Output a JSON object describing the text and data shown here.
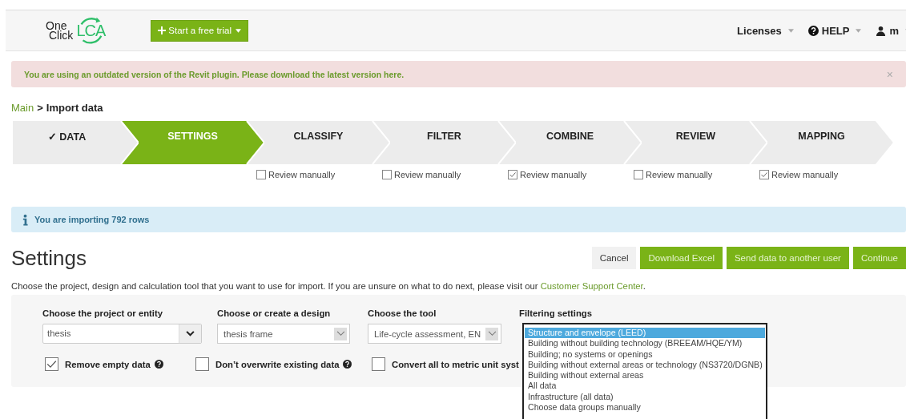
{
  "header": {
    "logo": {
      "line1": "One",
      "line2": "Click",
      "mark": "LCA"
    },
    "trial_button": "Start a free trial",
    "menu": [
      {
        "kind": "plain",
        "label": "Licenses"
      },
      {
        "kind": "help",
        "label": "HELP"
      },
      {
        "kind": "user",
        "label": "m"
      }
    ]
  },
  "alert": {
    "text": "You are using an outdated version of the Revit plugin. Please download the latest version here.",
    "close": "×"
  },
  "breadcrumb": {
    "link": "Main",
    "separator": ">",
    "current": "Import data"
  },
  "steps": [
    {
      "label": "✓ DATA",
      "selected": false
    },
    {
      "label": "SETTINGS",
      "selected": true
    },
    {
      "label": "CLASSIFY",
      "selected": false,
      "review": {
        "label": "Review manually",
        "checked": false
      }
    },
    {
      "label": "FILTER",
      "selected": false,
      "review": {
        "label": "Review manually",
        "checked": false
      }
    },
    {
      "label": "COMBINE",
      "selected": false,
      "review": {
        "label": "Review manually",
        "checked": true
      }
    },
    {
      "label": "REVIEW",
      "selected": false,
      "review": {
        "label": "Review manually",
        "checked": false
      }
    },
    {
      "label": "MAPPING",
      "selected": false,
      "review": {
        "label": "Review manually",
        "checked": true
      }
    }
  ],
  "info": "You are importing 792 rows",
  "settings": {
    "title": "Settings",
    "buttons": [
      {
        "kind": "secondary",
        "label": "Cancel"
      },
      {
        "kind": "primary",
        "label": "Download Excel"
      },
      {
        "kind": "primary",
        "label": "Send data to another user"
      },
      {
        "kind": "primary",
        "label": "Continue"
      }
    ],
    "description": "Choose the project, design and calculation tool that you want to use for import. If you are unsure on what to do next, please visit our ",
    "link": "Customer Support Center",
    "description_end": ".",
    "fields": [
      {
        "kind": "combo",
        "label": "Choose the project or entity",
        "value": "thesis"
      },
      {
        "kind": "select",
        "label": "Choose or create a design",
        "value": "thesis frame"
      },
      {
        "kind": "select",
        "label": "Choose the tool",
        "value": "Life-cycle assessment, EN"
      }
    ],
    "filter": {
      "label": "Filtering settings",
      "options": [
        {
          "label": "Structure and envelope (LEED)",
          "selected": true
        },
        {
          "label": "Building without building technology (BREEAM/HQE/YM)",
          "selected": false
        },
        {
          "label": "Building; no systems or openings",
          "selected": false
        },
        {
          "label": "Building without external areas or technology (NS3720/DGNB)",
          "selected": false
        },
        {
          "label": "Building without external areas",
          "selected": false
        },
        {
          "label": "All data",
          "selected": false
        },
        {
          "label": "Infrastructure (all data)",
          "selected": false
        },
        {
          "label": "Choose data groups manually",
          "selected": false
        }
      ]
    },
    "checkboxes": [
      {
        "label": "Remove empty data",
        "checked": true,
        "help": true
      },
      {
        "label": "Don’t overwrite existing data",
        "checked": false,
        "help": true
      },
      {
        "label": "Convert all to metric unit syst",
        "checked": false,
        "help": false
      }
    ]
  }
}
